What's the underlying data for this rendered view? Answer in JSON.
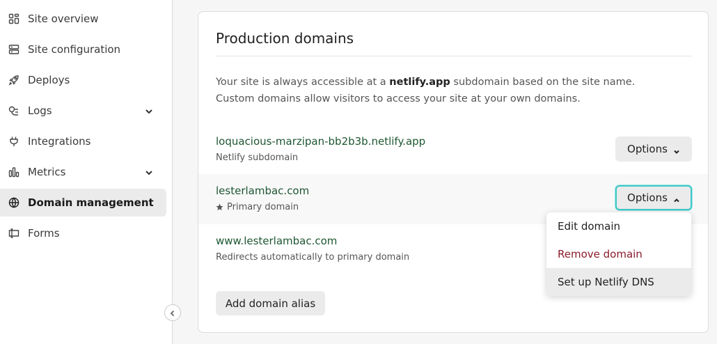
{
  "sidebar": {
    "items": [
      {
        "label": "Site overview",
        "icon": "grid-icon"
      },
      {
        "label": "Site configuration",
        "icon": "server-icon"
      },
      {
        "label": "Deploys",
        "icon": "rocket-icon"
      },
      {
        "label": "Logs",
        "icon": "logs-icon"
      },
      {
        "label": "Integrations",
        "icon": "plug-icon"
      },
      {
        "label": "Metrics",
        "icon": "bar-chart-icon"
      },
      {
        "label": "Domain management",
        "icon": "globe-icon",
        "active": true
      },
      {
        "label": "Forms",
        "icon": "form-icon"
      }
    ]
  },
  "card": {
    "title": "Production domains",
    "description_pre": "Your site is always accessible at a ",
    "description_bold": "netlify.app",
    "description_post": " subdomain based on the site name. Custom domains allow visitors to access your site at your own domains.",
    "domains": [
      {
        "name": "loquacious-marzipan-bb2b3b.netlify.app",
        "sub": "Netlify subdomain",
        "options_label": "Options"
      },
      {
        "name": "lesterlambac.com",
        "sub": "Primary domain",
        "options_label": "Options"
      },
      {
        "name": "www.lesterlambac.com",
        "sub": "Redirects automatically to primary domain"
      }
    ],
    "add_alias_label": "Add domain alias"
  },
  "dropdown": {
    "items": [
      "Edit domain",
      "Remove domain",
      "Set up Netlify DNS"
    ]
  },
  "colors": {
    "domain_link": "#1e5631",
    "danger": "#8a1c2b",
    "focus_ring": "#3dc9c7"
  }
}
